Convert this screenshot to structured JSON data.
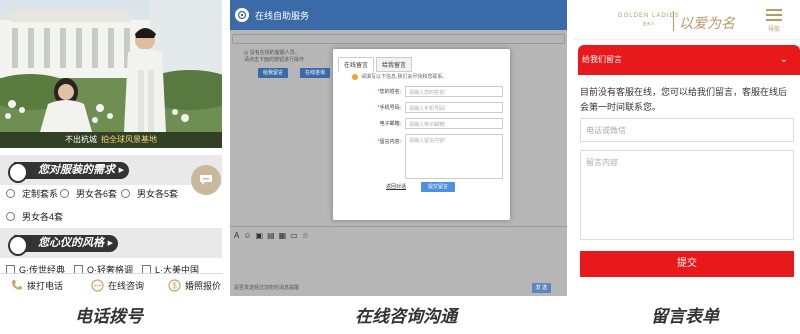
{
  "panel1": {
    "banner_caption": "不出杭城",
    "banner_highlight": "拍全球风景基地",
    "section1_title": "您对服装的需求",
    "options1": [
      "定制套系",
      "男女各6套",
      "男女各5套",
      "男女各4套"
    ],
    "section2_title": "您心仪的风格",
    "options2": [
      "G·传世经典",
      "O·轻奢格调",
      "L·大美中国"
    ],
    "bottom_bar": [
      "拨打电话",
      "在线咨询",
      "婚照报价"
    ]
  },
  "panel2": {
    "window_title": "在线自助服务",
    "info_lines": [
      "◎ 没有在线的客服人员。",
      "请点击下面的按钮进行操作"
    ],
    "mini_buttons": [
      "给我留言",
      "在线咨询"
    ],
    "modal": {
      "tabs": [
        "在线留言",
        "给我留言"
      ],
      "notice": "请填写以下信息,我们会尽快和您联系。",
      "fields": [
        {
          "label": "您的姓名:",
          "required": "*",
          "placeholder": "请输入您的姓名!"
        },
        {
          "label": "手机号码:",
          "required": "*",
          "placeholder": "请输入手机号码!"
        },
        {
          "label": "电子邮箱:",
          "required": "",
          "placeholder": "请输入电子邮箱!"
        },
        {
          "label": "留言内容:",
          "required": "*",
          "placeholder": "请输入留言内容!"
        }
      ],
      "back_label": "返回对话",
      "submit_label": "提交留言"
    },
    "footer_text": "是否发送经过加密的消息提醒",
    "send_label": "发 送"
  },
  "panel3": {
    "brand_name": "GOLDEN LADIES",
    "brand_sub": "金夫人",
    "brand_script": "以爱为名",
    "menu_label": "导航",
    "form_header": "给我们留言",
    "collapse_icon": "⌄",
    "description": "目前没有客服在线，您可以给我们留言，客服在线后会第一时间联系您。",
    "contact_placeholder": "电话或微信",
    "message_placeholder": "留言内容",
    "submit_label": "提交"
  },
  "captions": [
    "电话拨号",
    "在线咨询沟通",
    "留言表单"
  ],
  "colors": {
    "accent_red": "#e8191a",
    "chat_blue": "#3b6aa8",
    "gold": "#b69a68"
  }
}
